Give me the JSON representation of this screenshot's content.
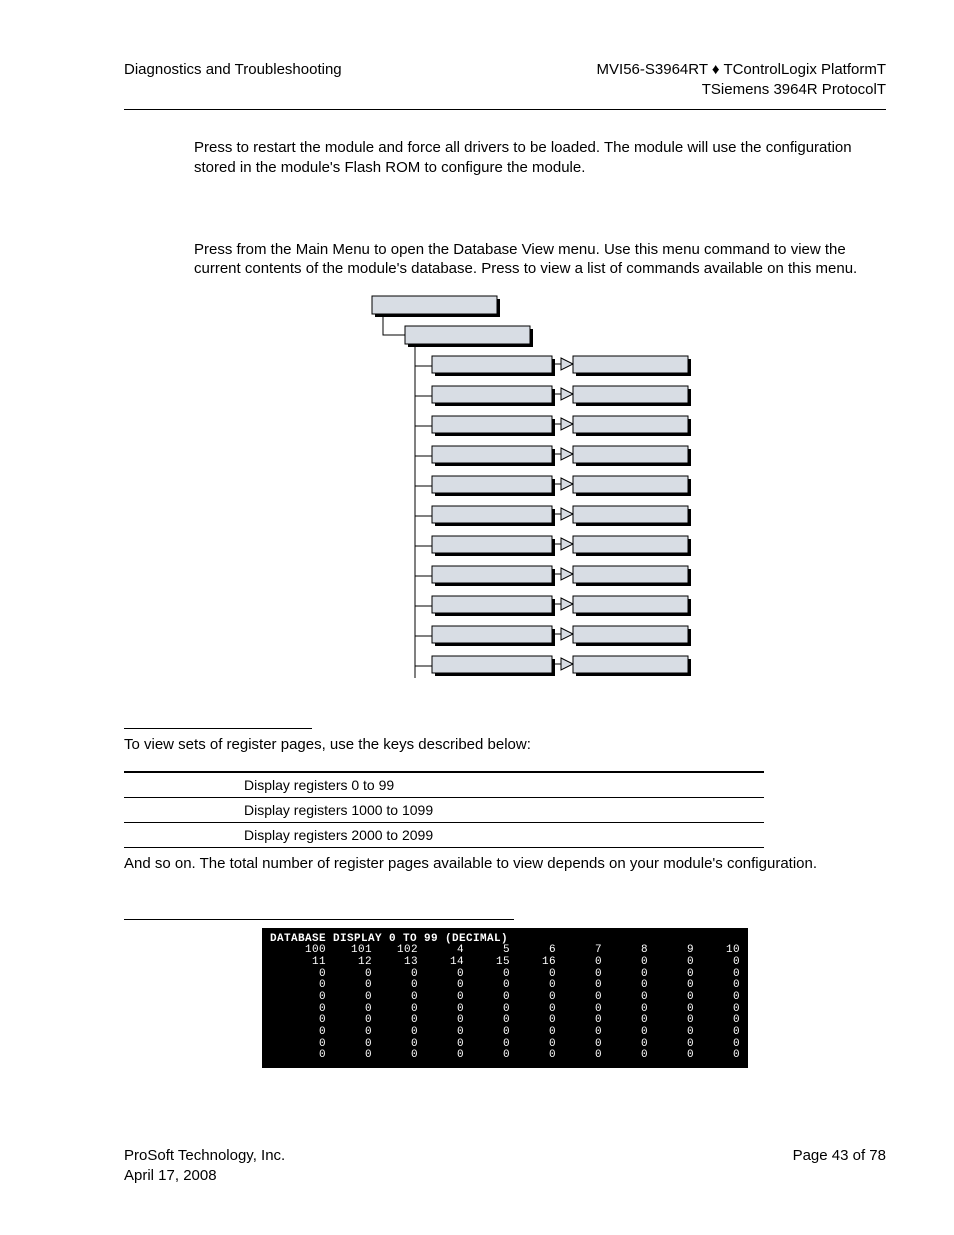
{
  "header": {
    "left": "Diagnostics and Troubleshooting",
    "right_line1": "MVI56-S3964RT ♦ TControlLogix PlatformT",
    "right_line2": "TSiemens 3964R ProtocolT"
  },
  "body": {
    "para1": "Press         to restart the module and force all drivers to be loaded. The module will use the configuration stored in the module's Flash ROM to configure the module.",
    "para2": "Press        from the Main Menu to open the Database View menu. Use this menu command to view the current contents of the module's database. Press        to view a list of commands available on this menu.",
    "section1_text": "To view sets of register pages, use the keys described below:",
    "table": {
      "rows": [
        {
          "desc": "Display registers 0 to 99"
        },
        {
          "desc": "Display registers 1000 to 1099"
        },
        {
          "desc": "Display registers 2000 to 2099"
        }
      ]
    },
    "section1_after": "And so on. The total number of register pages available to view depends on your module's configuration.",
    "terminal": {
      "title": "DATABASE DISPLAY 0 TO 99 (DECIMAL)",
      "rows": [
        [
          "100",
          "101",
          "102",
          "4",
          "5",
          "6",
          "7",
          "8",
          "9",
          "10"
        ],
        [
          "11",
          "12",
          "13",
          "14",
          "15",
          "16",
          "0",
          "0",
          "0",
          "0"
        ],
        [
          "0",
          "0",
          "0",
          "0",
          "0",
          "0",
          "0",
          "0",
          "0",
          "0"
        ],
        [
          "0",
          "0",
          "0",
          "0",
          "0",
          "0",
          "0",
          "0",
          "0",
          "0"
        ],
        [
          "0",
          "0",
          "0",
          "0",
          "0",
          "0",
          "0",
          "0",
          "0",
          "0"
        ],
        [
          "0",
          "0",
          "0",
          "0",
          "0",
          "0",
          "0",
          "0",
          "0",
          "0"
        ],
        [
          "0",
          "0",
          "0",
          "0",
          "0",
          "0",
          "0",
          "0",
          "0",
          "0"
        ],
        [
          "0",
          "0",
          "0",
          "0",
          "0",
          "0",
          "0",
          "0",
          "0",
          "0"
        ],
        [
          "0",
          "0",
          "0",
          "0",
          "0",
          "0",
          "0",
          "0",
          "0",
          "0"
        ],
        [
          "0",
          "0",
          "0",
          "0",
          "0",
          "0",
          "0",
          "0",
          "0",
          "0"
        ]
      ]
    }
  },
  "footer": {
    "company": "ProSoft Technology, Inc.",
    "date": "April 17, 2008",
    "page": "Page 43 of 78"
  }
}
